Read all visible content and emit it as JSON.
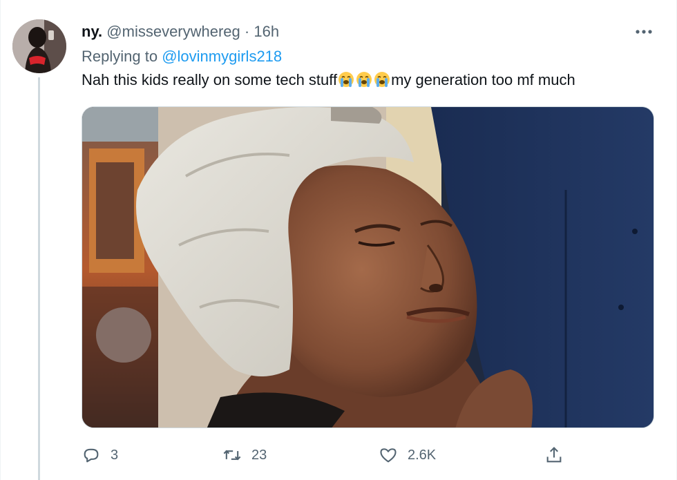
{
  "tweet": {
    "display_name": "ny.",
    "handle": "@misseverywhereg",
    "separator": "·",
    "time": "16h",
    "replying_prefix": "Replying to",
    "replying_to": "@lovinmygirls218",
    "text_before": "Nah this kids really on some tech stuff",
    "text_after": "my generation too mf much",
    "emoji": [
      "loudly-crying-face",
      "loudly-crying-face",
      "loudly-crying-face"
    ]
  },
  "actions": {
    "reply_count": "3",
    "retweet_count": "23",
    "like_count": "2.6K"
  },
  "icons": {
    "more": "more-horizontal-icon",
    "reply": "reply-icon",
    "retweet": "retweet-icon",
    "like": "heart-icon",
    "share": "share-icon"
  },
  "colors": {
    "text": "#0f1419",
    "secondary": "#536471",
    "link": "#1d9bf0",
    "line": "#cfd9de"
  }
}
